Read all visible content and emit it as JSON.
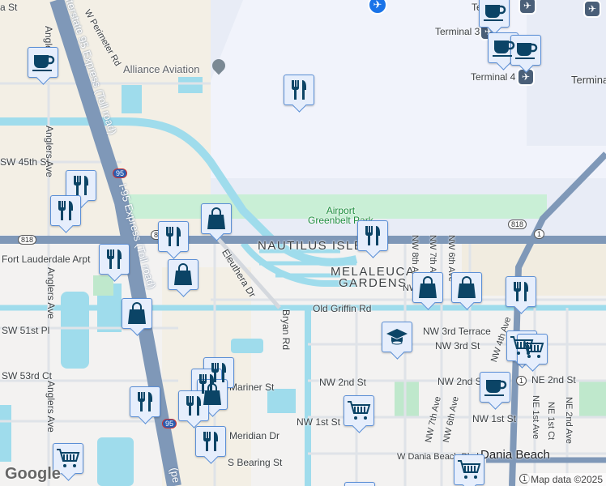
{
  "map": {
    "labels": {
      "alliance_aviation": "Alliance Aviation",
      "w_perimeter_rd": "W Perimeter Rd",
      "i95_express_top": "Interstate 95 Express (Toll road)",
      "i95_express_mid": "I-95 Express (Toll road)",
      "i95_express_bottom": "(pe",
      "sw_45th_st": "SW 45th St",
      "anglers_ave_1": "Anglers Ave",
      "anglers_ave_2": "Anglers Ave",
      "anglers_ave_3": "Anglers Ave",
      "fort_lauderdale_arpt": "Fort Lauderdale Arpt",
      "sw_51st_pl": "SW 51st Pl",
      "sw_53rd_ct": "SW 53rd Ct",
      "eleuthera_dr": "Eleuthera Dr",
      "bryan_rd": "Bryan Rd",
      "nautilus_isle": "NAUTILUS ISLE",
      "melaleuca_gardens_1": "MELALEUCA",
      "melaleuca_gardens_2": "GARDENS",
      "airport_greenbelt_park_1": "Airport",
      "airport_greenbelt_park_2": "Greenbelt Park",
      "terminal_3": "Terminal 3",
      "terminal_4": "Terminal 4",
      "terminal_partial": "Termina",
      "terminal_2_partial": "Te          2",
      "nw_8th_ave": "NW 8th Ave",
      "nw_7th_ave_top": "NW 7th Ave",
      "nw_6th_ave_top": "NW 6th Ave",
      "nw_partial": "NW",
      "old_griffin_rd": "Old Griffin Rd",
      "nw_3rd_terrace": "NW 3rd Terrace",
      "nw_3rd_st": "NW 3rd St",
      "nw_4th_ave": "NW 4th Ave",
      "nw_2nd_st_west": "NW 2nd St",
      "nw_2nd_st_east": "NW 2nd St",
      "ne_2nd_st": "NE 2nd St",
      "nw_1st_st_west": "NW 1st St",
      "nw_1st_st_east": "NW 1st St",
      "nw_7th_ave_bottom": "NW 7th Ave",
      "nw_6th_ave_bottom": "NW 6th Ave",
      "ne_1st_ave": "NE 1st Ave",
      "ne_1st_ct": "NE 1st Ct",
      "ne_2nd_ave": "NE 2nd Ave",
      "w_dania_beach_blvd": "W Dania Beach Blvd",
      "dania_beach": "Dania Beach",
      "mariner_st": "Mariner St",
      "meridian_dr": "Meridian Dr",
      "s_bearing_st": "S Bearing St",
      "top_st_partial": "a St"
    },
    "shields": {
      "sr818_a": "818",
      "sr818_b": "818",
      "sr818_c": "818",
      "us1_a": "1",
      "us1_b": "1",
      "us1_c": "1",
      "i95_a": "95",
      "i95_b": "95"
    },
    "attribution": "Map data ©2025",
    "logo": "Google",
    "colors": {
      "water": "#9fdcec",
      "highway": "#7f98b8",
      "park": "#bfe8cc",
      "airport": "#e8ecf6",
      "marker_bg": "#e6eefc",
      "marker_icon": "#0b4466"
    }
  }
}
